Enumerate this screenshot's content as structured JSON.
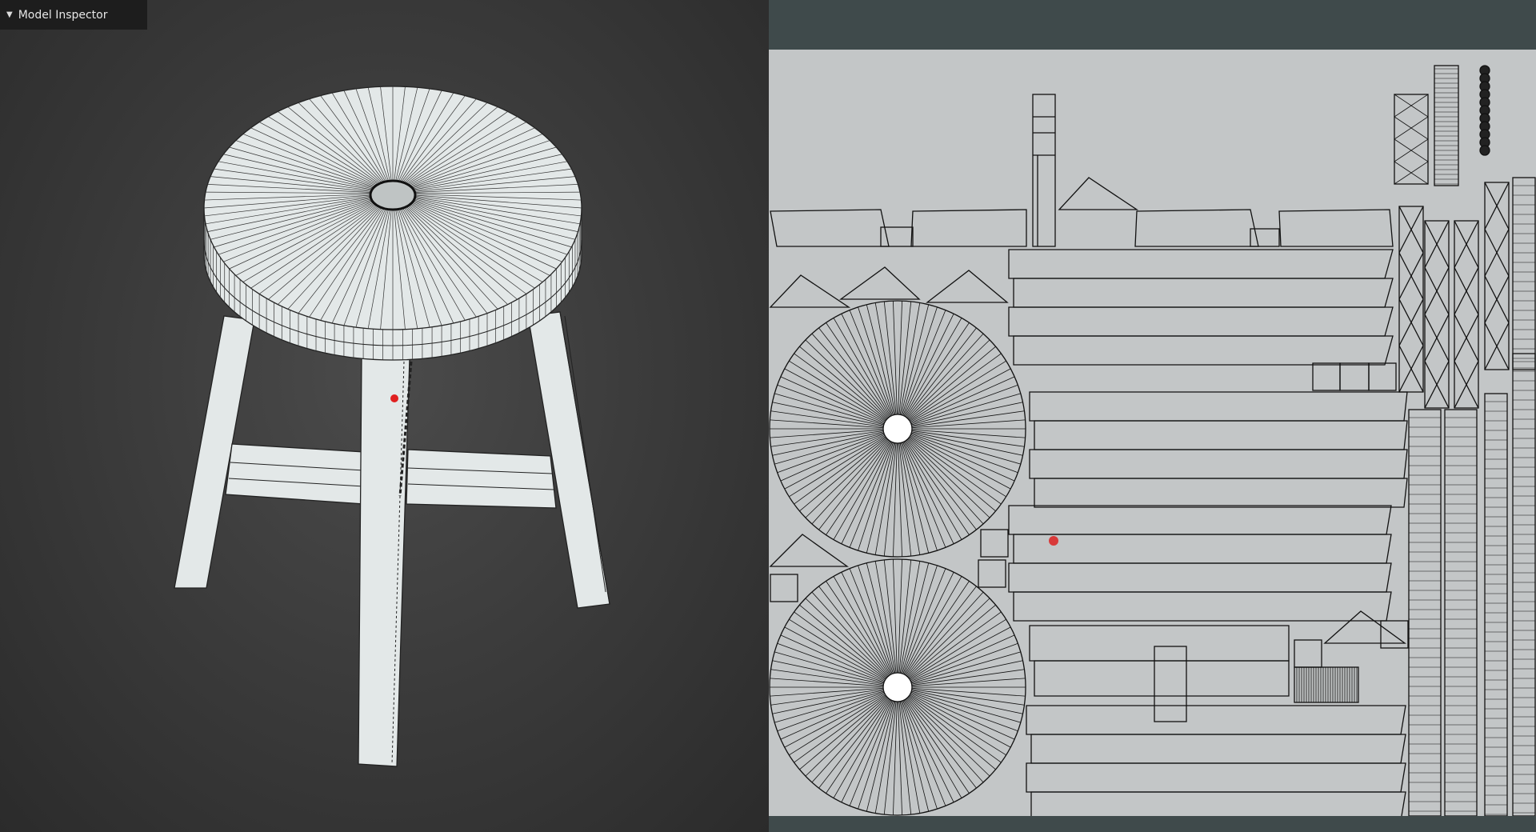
{
  "inspector": {
    "title": "Model Inspector",
    "expanded": true
  },
  "viewport": {
    "background": "#3a3a3a",
    "mesh_fill": "#e3e8e8",
    "wire_color": "#1a1a1a",
    "marker_color": "#e02020",
    "model": "stool"
  },
  "uv_editor": {
    "background": "#c3c6c7",
    "frame_color": "#3f4a4b",
    "line_color": "#111111",
    "marker_color": "#d83a3a"
  }
}
